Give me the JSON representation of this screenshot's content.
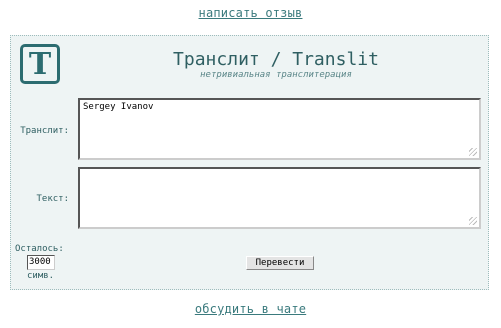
{
  "links": {
    "write_review": "написать отзыв",
    "discuss_chat": "обсудить в чате"
  },
  "header": {
    "logo_letter": "T",
    "title": "Транслит / Translit",
    "subtitle": "нетривиальная транслитерация"
  },
  "form": {
    "translit_label": "Транслит:",
    "translit_value": "Sergey Ivanov",
    "text_label": "Текст:",
    "text_value": "",
    "remaining_label": "Осталось:",
    "remaining_count": "3000",
    "chars_label": "симв.",
    "translate_button": "Перевести"
  },
  "colors": {
    "accent": "#2c6c70",
    "panel_bg": "#eef4f4",
    "link": "#3a7a7d"
  }
}
